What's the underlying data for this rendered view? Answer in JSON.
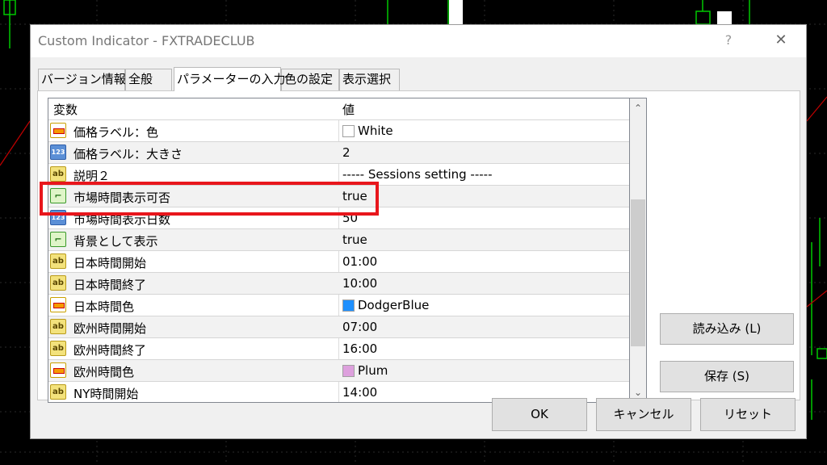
{
  "window": {
    "title": "Custom Indicator - FXTRADECLUB",
    "help_glyph": "?",
    "close_glyph": "✕"
  },
  "tabs": [
    {
      "label": "バージョン情報"
    },
    {
      "label": "全般"
    },
    {
      "label": "パラメーターの入力"
    },
    {
      "label": "色の設定"
    },
    {
      "label": "表示選択"
    }
  ],
  "table": {
    "col_variable": "変数",
    "col_value": "値",
    "rows": [
      {
        "type": "color",
        "name": "価格ラベル：色",
        "value": "White",
        "swatch": "#ffffff"
      },
      {
        "type": "num",
        "name": "価格ラベル：大きさ",
        "value": "2"
      },
      {
        "type": "str",
        "name": "説明２",
        "value": "----- Sessions setting -----"
      },
      {
        "type": "bool",
        "name": "市場時間表示可否",
        "value": "true"
      },
      {
        "type": "num",
        "name": "市場時間表示日数",
        "value": "50"
      },
      {
        "type": "bool",
        "name": "背景として表示",
        "value": "true"
      },
      {
        "type": "str",
        "name": "日本時間開始",
        "value": "01:00"
      },
      {
        "type": "str",
        "name": "日本時間終了",
        "value": "10:00"
      },
      {
        "type": "color",
        "name": "日本時間色",
        "value": "DodgerBlue",
        "swatch": "#1e90ff"
      },
      {
        "type": "str",
        "name": "欧州時間開始",
        "value": "07:00"
      },
      {
        "type": "str",
        "name": "欧州時間終了",
        "value": "16:00"
      },
      {
        "type": "color",
        "name": "欧州時間色",
        "value": "Plum",
        "swatch": "#dda0dd"
      },
      {
        "type": "str",
        "name": "NY時間開始",
        "value": "14:00"
      }
    ]
  },
  "icons": {
    "color": "color-param-icon",
    "num": "number-param-icon",
    "str": "string-param-icon",
    "bool": "bool-param-icon",
    "num_text": "123",
    "str_text": "ab",
    "bool_text": "⌐"
  },
  "buttons": {
    "load": "読み込み (L)",
    "save": "保存 (S)",
    "ok": "OK",
    "cancel": "キャンセル",
    "reset": "リセット"
  },
  "highlight_color": "#e8161c"
}
